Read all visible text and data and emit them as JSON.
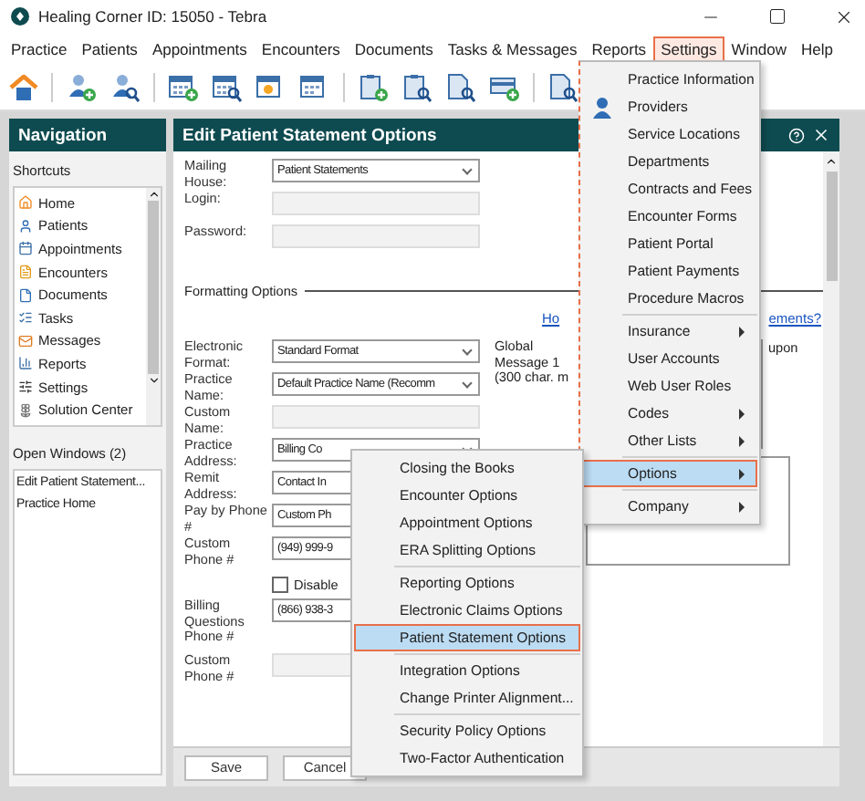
{
  "window": {
    "title": "Healing Corner ID: 15050 - Tebra"
  },
  "menu_bar": [
    {
      "label": "Practice",
      "selected": false
    },
    {
      "label": "Patients",
      "selected": false
    },
    {
      "label": "Appointments",
      "selected": false
    },
    {
      "label": "Encounters",
      "selected": false
    },
    {
      "label": "Documents",
      "selected": false
    },
    {
      "label": "Tasks & Messages",
      "selected": false
    },
    {
      "label": "Reports",
      "selected": false
    },
    {
      "label": "Settings",
      "selected": true
    },
    {
      "label": "Window",
      "selected": false
    },
    {
      "label": "Help",
      "selected": false
    }
  ],
  "navigation": {
    "title": "Navigation",
    "shortcuts_label": "Shortcuts",
    "shortcuts": [
      "Home",
      "Patients",
      "Appointments",
      "Encounters",
      "Documents",
      "Tasks",
      "Messages",
      "Reports",
      "Settings",
      "Solution Center"
    ],
    "open_windows_label": "Open Windows (2)",
    "open_windows": [
      "Edit Patient Statement...",
      "Practice Home"
    ]
  },
  "editor": {
    "title": "Edit Patient Statement Options",
    "account_fields": [
      {
        "label": "Mailing House:",
        "kind": "select",
        "value": "Patient Statements",
        "disabled": false
      },
      {
        "label": "Login:",
        "kind": "input",
        "disabled": true
      },
      {
        "label": "Password:",
        "kind": "input",
        "disabled": true
      }
    ],
    "section_title": "Formatting Options",
    "help_link_parts": [
      "Ho",
      "ements?"
    ],
    "fields": [
      {
        "label": "Electronic Format:",
        "kind": "select",
        "value": "Standard Format",
        "disabled": false
      },
      {
        "label": "Practice Name:",
        "kind": "select",
        "value": "Default Practice Name (Recomm",
        "disabled": false
      },
      {
        "label": "Custom Name:",
        "kind": "input",
        "disabled": true
      },
      {
        "label": "Practice Address:",
        "kind": "select",
        "value": "Billing Co",
        "disabled": false
      },
      {
        "label": "Remit Address:",
        "kind": "select",
        "value": "Contact In",
        "disabled": false
      },
      {
        "label": "Pay by Phone #",
        "kind": "select",
        "value": "Custom Ph",
        "disabled": false
      },
      {
        "label": "Custom Phone #",
        "kind": "input",
        "value": "(949) 999-9",
        "disabled": false
      },
      {
        "label": "Disable",
        "kind": "checkbox",
        "checked": false
      },
      {
        "label": "Billing Questions Phone #",
        "kind": "input",
        "value": "(866) 938-3",
        "disabled": false
      },
      {
        "label": "Custom Phone #",
        "kind": "input",
        "disabled": true
      }
    ],
    "global_message_label": "Global Message 1 (300 char. m",
    "coupon_label": "upon",
    "buttons": [
      "Save",
      "Cancel"
    ]
  },
  "settings_menu": [
    {
      "label": "Practice Information",
      "kind": "item",
      "selected": false
    },
    {
      "label": "Providers",
      "kind": "item",
      "selected": false
    },
    {
      "label": "Service Locations",
      "kind": "item",
      "selected": false
    },
    {
      "label": "Departments",
      "kind": "item",
      "selected": false
    },
    {
      "label": "Contracts and Fees",
      "kind": "item",
      "selected": false
    },
    {
      "label": "Encounter Forms",
      "kind": "item",
      "selected": false
    },
    {
      "label": "Patient Portal",
      "kind": "item",
      "selected": false
    },
    {
      "label": "Patient Payments",
      "kind": "item",
      "selected": false
    },
    {
      "label": "Procedure Macros",
      "kind": "item",
      "selected": false
    },
    {
      "kind": "separator"
    },
    {
      "label": "Insurance",
      "kind": "submenu",
      "selected": false
    },
    {
      "label": "User Accounts",
      "kind": "item",
      "selected": false
    },
    {
      "label": "Web User Roles",
      "kind": "item",
      "selected": false
    },
    {
      "label": "Codes",
      "kind": "submenu",
      "selected": false
    },
    {
      "label": "Other Lists",
      "kind": "submenu",
      "selected": false
    },
    {
      "kind": "separator"
    },
    {
      "label": "Options",
      "kind": "submenu",
      "selected": true
    },
    {
      "kind": "separator"
    },
    {
      "label": "Company",
      "kind": "submenu",
      "selected": false
    }
  ],
  "options_menu": [
    {
      "label": "Closing the Books",
      "kind": "item",
      "selected": false
    },
    {
      "label": "Encounter Options",
      "kind": "item",
      "selected": false
    },
    {
      "label": "Appointment Options",
      "kind": "item",
      "selected": false
    },
    {
      "label": "ERA Splitting Options",
      "kind": "item",
      "selected": false
    },
    {
      "kind": "separator"
    },
    {
      "label": "Reporting Options",
      "kind": "item",
      "selected": false
    },
    {
      "label": "Electronic Claims Options",
      "kind": "item",
      "selected": false
    },
    {
      "label": "Patient Statement Options",
      "kind": "item",
      "selected": true
    },
    {
      "kind": "separator"
    },
    {
      "label": "Integration Options",
      "kind": "item",
      "selected": false
    },
    {
      "label": "Change Printer Alignment...",
      "kind": "item",
      "selected": false
    },
    {
      "kind": "separator"
    },
    {
      "label": "Security Policy Options",
      "kind": "item",
      "selected": false
    },
    {
      "label": "Two-Factor Authentication",
      "kind": "item",
      "selected": false
    }
  ]
}
